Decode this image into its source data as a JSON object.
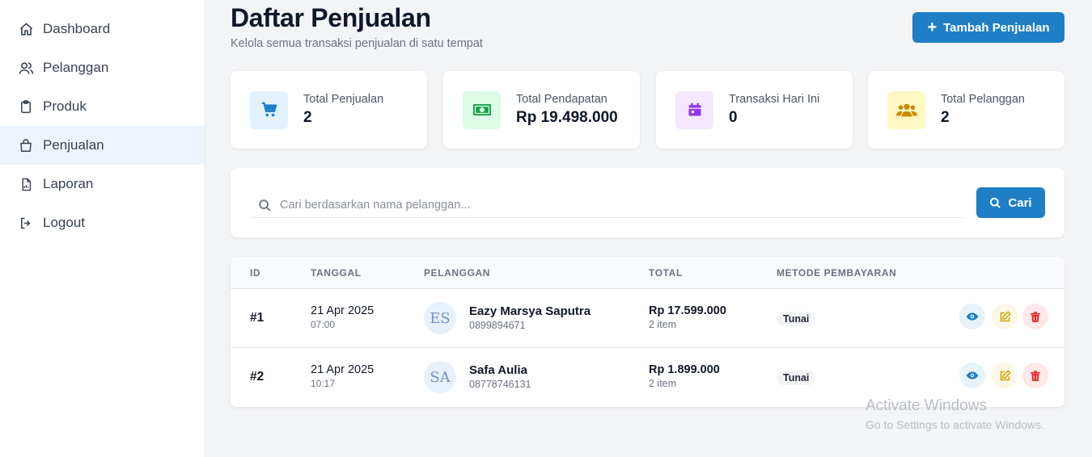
{
  "sidebar": {
    "items": [
      {
        "label": "Dashboard",
        "icon": "home-icon"
      },
      {
        "label": "Pelanggan",
        "icon": "users-icon"
      },
      {
        "label": "Produk",
        "icon": "clipboard-icon"
      },
      {
        "label": "Penjualan",
        "icon": "shopping-bag-icon",
        "active": true
      },
      {
        "label": "Laporan",
        "icon": "report-icon"
      },
      {
        "label": "Logout",
        "icon": "logout-icon"
      }
    ]
  },
  "header": {
    "title": "Daftar Penjualan",
    "subtitle": "Kelola semua transaksi penjualan di satu tempat",
    "add_button": "Tambah Penjualan"
  },
  "stats": [
    {
      "label": "Total Penjualan",
      "value": "2",
      "icon": "cart-icon",
      "color": "#1e7fc6",
      "bg": "#e3f1fc"
    },
    {
      "label": "Total Pendapatan",
      "value": "Rp 19.498.000",
      "icon": "money-icon",
      "color": "#16a34a",
      "bg": "#dcfce7"
    },
    {
      "label": "Transaksi Hari Ini",
      "value": "0",
      "icon": "calendar-icon",
      "color": "#9333ea",
      "bg": "#f3e8ff"
    },
    {
      "label": "Total Pelanggan",
      "value": "2",
      "icon": "users-group-icon",
      "color": "#ca8a04",
      "bg": "#fef9c3"
    }
  ],
  "search": {
    "placeholder": "Cari berdasarkan nama pelanggan...",
    "value": "",
    "button": "Cari"
  },
  "table": {
    "columns": [
      "ID",
      "TANGGAL",
      "PELANGGAN",
      "TOTAL",
      "METODE PEMBAYARAN"
    ],
    "rows": [
      {
        "id": "#1",
        "date": "21 Apr 2025",
        "time": "07:00",
        "initials": "ES",
        "name": "Eazy Marsya Saputra",
        "phone": "0899894671",
        "total": "Rp 17.599.000",
        "items": "2 item",
        "method": "Tunai"
      },
      {
        "id": "#2",
        "date": "21 Apr 2025",
        "time": "10:17",
        "initials": "SA",
        "name": "Safa Aulia",
        "phone": "08778746131",
        "total": "Rp 1.899.000",
        "items": "2 item",
        "method": "Tunai"
      }
    ]
  },
  "watermark": {
    "line1": "Activate Windows",
    "line2": "Go to Settings to activate Windows."
  },
  "colors": {
    "primary": "#1e7fc6",
    "view": "#1e7fc6",
    "edit": "#d4a20a",
    "delete": "#dc2626"
  }
}
